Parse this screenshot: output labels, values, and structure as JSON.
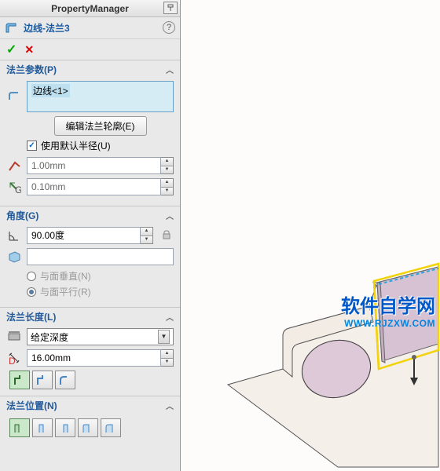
{
  "titlebar": {
    "text": "PropertyManager"
  },
  "feature": {
    "title": "边线-法兰3"
  },
  "sections": {
    "flange_params": {
      "header": "法兰参数(P)",
      "edge_selection": "边线<1>",
      "edit_profile_btn": "编辑法兰轮廓(E)",
      "use_default_radius": "使用默认半径(U)",
      "bend_radius": "1.00mm",
      "gap_distance": "0.10mm"
    },
    "angle": {
      "header": "角度(G)",
      "value": "90.00度",
      "face_value": "",
      "perpendicular": "与面垂直(N)",
      "parallel": "与面平行(R)"
    },
    "length": {
      "header": "法兰长度(L)",
      "end_condition": "给定深度",
      "value": "16.00mm"
    },
    "position": {
      "header": "法兰位置(N)"
    }
  },
  "watermark": {
    "line1": "软件自学网",
    "line2": "WWW.RJZXW.COM"
  }
}
